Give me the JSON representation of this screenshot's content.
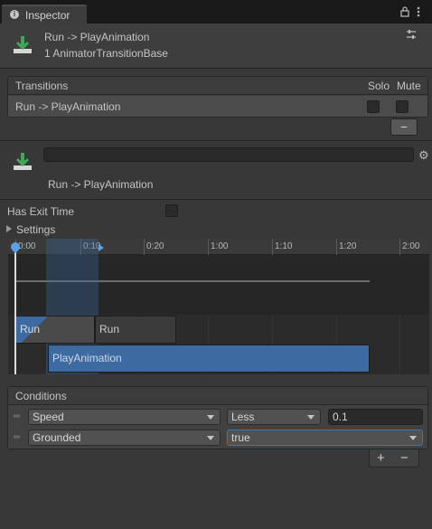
{
  "tab": {
    "label": "Inspector",
    "icon": "info-icon"
  },
  "tab_icons": [
    "lock-icon",
    "more-vertical-icon"
  ],
  "header": {
    "title": "Run -> PlayAnimation",
    "subtitle": "1 AnimatorTransitionBase",
    "icon": "transition-icon",
    "settings_icon": "sliders-icon"
  },
  "transitions": {
    "title": "Transitions",
    "solo_label": "Solo",
    "mute_label": "Mute",
    "items": [
      {
        "name": "Run -> PlayAnimation",
        "solo": false,
        "mute": false
      }
    ],
    "remove_label": "−"
  },
  "transition_detail": {
    "name_value": "",
    "label": "Run -> PlayAnimation",
    "icon": "transition-icon",
    "gear_icon": "gear-icon"
  },
  "has_exit_time": {
    "label": "Has Exit Time",
    "checked": false
  },
  "settings": {
    "label": "Settings",
    "expanded": false
  },
  "timeline": {
    "ticks": [
      "0:00",
      "0:10",
      "0:20",
      "1:00",
      "1:10",
      "1:20",
      "2:00"
    ],
    "clips": [
      {
        "label": "Run"
      },
      {
        "label": "Run"
      },
      {
        "label": "PlayAnimation"
      }
    ]
  },
  "conditions": {
    "title": "Conditions",
    "rows": [
      {
        "parameter": "Speed",
        "operator": "Less",
        "value": "0.1"
      },
      {
        "parameter": "Grounded",
        "value": "true"
      }
    ],
    "add_label": "+",
    "remove_label": "−"
  },
  "colors": {
    "accent": "#3a5f91",
    "clip_blue": "#3d6aa0",
    "clip_gray": "#3b3b3b",
    "panel_bg": "#383838"
  }
}
